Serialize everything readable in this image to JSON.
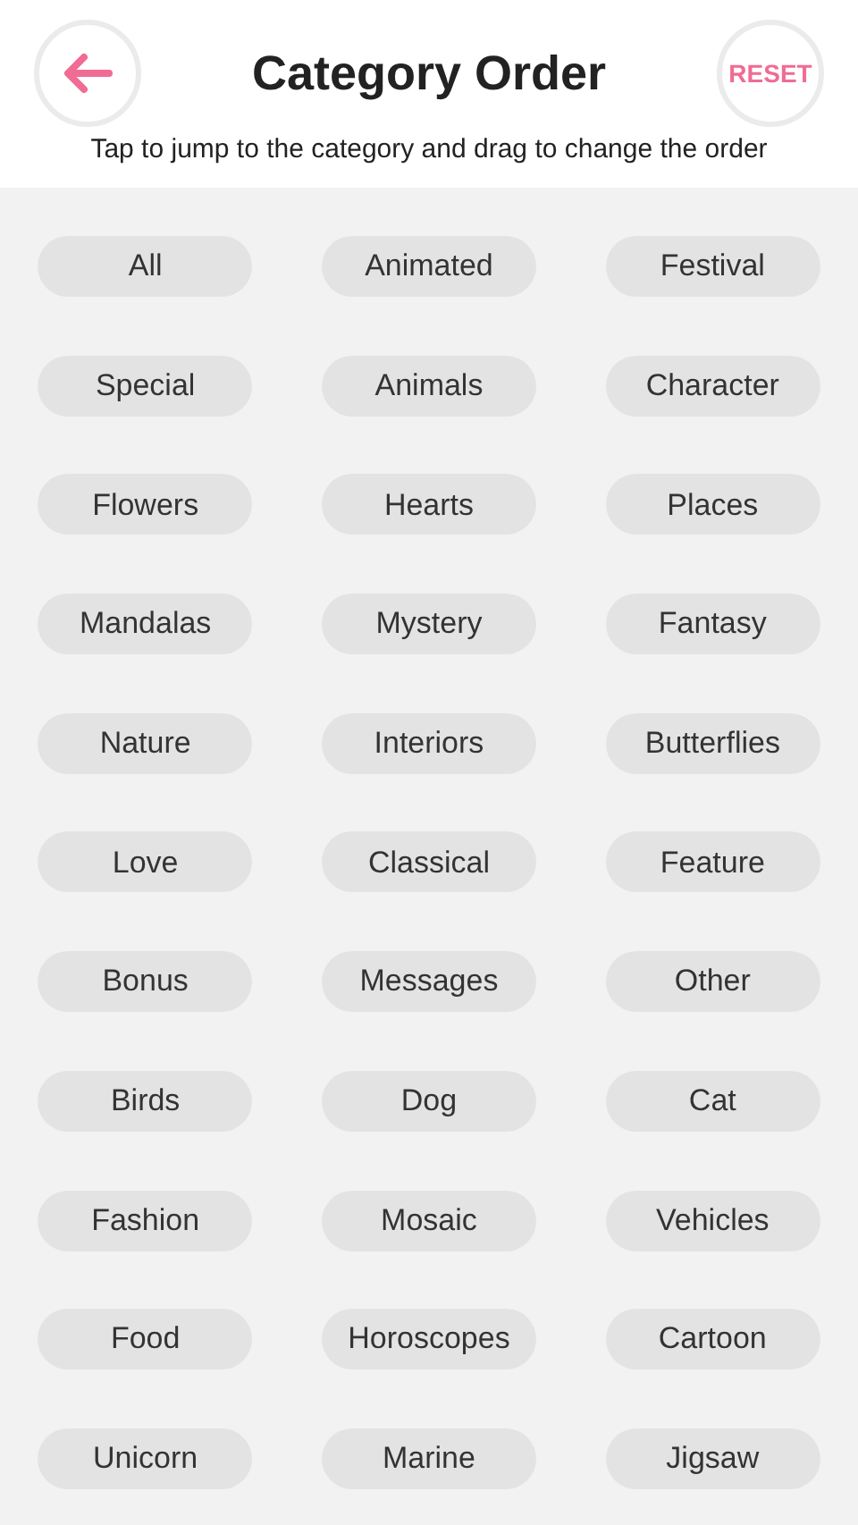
{
  "header": {
    "title": "Category Order",
    "reset_label": "RESET",
    "hint": "Tap to jump to the category and drag to change the order"
  },
  "categories": [
    "All",
    "Animated",
    "Festival",
    "Special",
    "Animals",
    "Character",
    "Flowers",
    "Hearts",
    "Places",
    "Mandalas",
    "Mystery",
    "Fantasy",
    "Nature",
    "Interiors",
    "Butterflies",
    "Love",
    "Classical",
    "Feature",
    "Bonus",
    "Messages",
    "Other",
    "Birds",
    "Dog",
    "Cat",
    "Fashion",
    "Mosaic",
    "Vehicles",
    "Food",
    "Horoscopes",
    "Cartoon",
    "Unicorn",
    "Marine",
    "Jigsaw"
  ]
}
